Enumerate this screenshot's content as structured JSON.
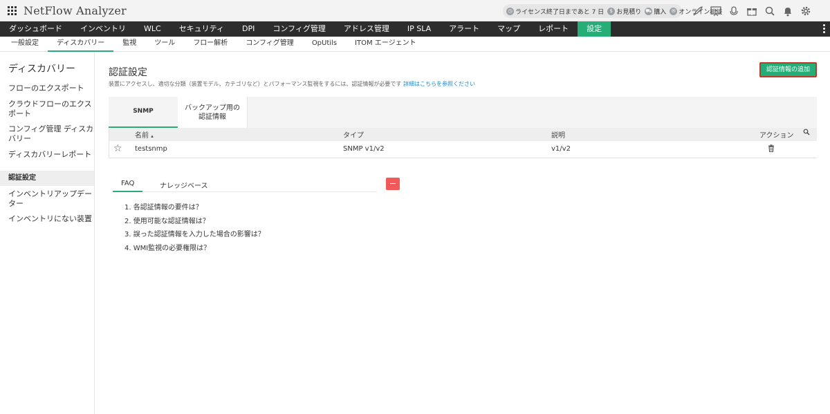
{
  "header": {
    "app_title": "NetFlow Analyzer",
    "license_segments": [
      {
        "icon": "clock-icon",
        "label": "ライセンス終了日まであと 7 日"
      },
      {
        "icon": "dollar-icon",
        "label": "お見積り"
      },
      {
        "icon": "cart-icon",
        "label": "購入"
      },
      {
        "icon": "chat-icon",
        "label": "オンライン相談"
      }
    ],
    "icons": [
      "rocket-icon",
      "presentation-icon",
      "microphone-icon",
      "gift-icon",
      "search-icon",
      "bell-icon",
      "gear-icon"
    ]
  },
  "main_nav": {
    "items": [
      "ダッシュボード",
      "インベントリ",
      "WLC",
      "セキュリティ",
      "DPI",
      "コンフィグ管理",
      "アドレス管理",
      "IP SLA",
      "アラート",
      "マップ",
      "レポート",
      "設定"
    ],
    "active": "設定"
  },
  "sub_nav": {
    "items": [
      "一般設定",
      "ディスカバリー",
      "監視",
      "ツール",
      "フロー解析",
      "コンフィグ管理",
      "OpUtils",
      "ITOM エージェント"
    ],
    "active": "ディスカバリー"
  },
  "sidebar": {
    "title": "ディスカバリー",
    "items": [
      "フローのエクスポート",
      "クラウドフローのエクスポート",
      "コンフィグ管理 ディスカバリー",
      "ディスカバリーレポート",
      "認証設定",
      "インベントリアップデーター",
      "インベントリにない装置"
    ],
    "active": "認証設定"
  },
  "page": {
    "title": "認証設定",
    "description": "装置にアクセスし、適切な分類（装置モデル、カテゴリなど）とパフォーマンス監視をするには、認証情報が必要です",
    "link_text": "詳細はこちらを参照ください",
    "add_button": "認証情報の追加"
  },
  "credential_tabs": {
    "snmp": "SNMP",
    "backup_line1": "バックアップ用の",
    "backup_line2": "認証情報"
  },
  "table": {
    "columns": {
      "name": "名前",
      "type": "タイプ",
      "description": "説明",
      "action": "アクション"
    },
    "rows": [
      {
        "name": "testsnmp",
        "type": "SNMP v1/v2",
        "description": "v1/v2"
      }
    ]
  },
  "faq": {
    "tabs": [
      "FAQ",
      "ナレッジベース"
    ],
    "active": "FAQ",
    "questions": [
      "1. 各認証情報の要件は？",
      "2. 使用可能な認証情報は？",
      "3. 誤った認証情報を入力した場合の影響は？",
      "4. WMI監視の必要権限は？"
    ]
  },
  "colors": {
    "accent": "#27ae78",
    "nav_bg": "#2d2d2d",
    "link": "#1a8bd6",
    "collapse": "#f15a5a",
    "highlight_border": "#c0392b"
  }
}
